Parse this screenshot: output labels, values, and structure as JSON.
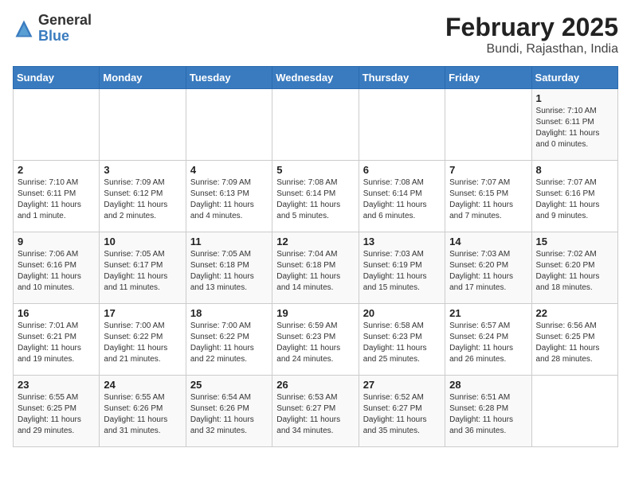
{
  "header": {
    "logo_general": "General",
    "logo_blue": "Blue",
    "title": "February 2025",
    "subtitle": "Bundi, Rajasthan, India"
  },
  "days_of_week": [
    "Sunday",
    "Monday",
    "Tuesday",
    "Wednesday",
    "Thursday",
    "Friday",
    "Saturday"
  ],
  "weeks": [
    [
      {
        "day": "",
        "info": ""
      },
      {
        "day": "",
        "info": ""
      },
      {
        "day": "",
        "info": ""
      },
      {
        "day": "",
        "info": ""
      },
      {
        "day": "",
        "info": ""
      },
      {
        "day": "",
        "info": ""
      },
      {
        "day": "1",
        "info": "Sunrise: 7:10 AM\nSunset: 6:11 PM\nDaylight: 11 hours\nand 0 minutes."
      }
    ],
    [
      {
        "day": "2",
        "info": "Sunrise: 7:10 AM\nSunset: 6:11 PM\nDaylight: 11 hours\nand 1 minute."
      },
      {
        "day": "3",
        "info": "Sunrise: 7:09 AM\nSunset: 6:12 PM\nDaylight: 11 hours\nand 2 minutes."
      },
      {
        "day": "4",
        "info": "Sunrise: 7:09 AM\nSunset: 6:13 PM\nDaylight: 11 hours\nand 4 minutes."
      },
      {
        "day": "5",
        "info": "Sunrise: 7:08 AM\nSunset: 6:14 PM\nDaylight: 11 hours\nand 5 minutes."
      },
      {
        "day": "6",
        "info": "Sunrise: 7:08 AM\nSunset: 6:14 PM\nDaylight: 11 hours\nand 6 minutes."
      },
      {
        "day": "7",
        "info": "Sunrise: 7:07 AM\nSunset: 6:15 PM\nDaylight: 11 hours\nand 7 minutes."
      },
      {
        "day": "8",
        "info": "Sunrise: 7:07 AM\nSunset: 6:16 PM\nDaylight: 11 hours\nand 9 minutes."
      }
    ],
    [
      {
        "day": "9",
        "info": "Sunrise: 7:06 AM\nSunset: 6:16 PM\nDaylight: 11 hours\nand 10 minutes."
      },
      {
        "day": "10",
        "info": "Sunrise: 7:05 AM\nSunset: 6:17 PM\nDaylight: 11 hours\nand 11 minutes."
      },
      {
        "day": "11",
        "info": "Sunrise: 7:05 AM\nSunset: 6:18 PM\nDaylight: 11 hours\nand 13 minutes."
      },
      {
        "day": "12",
        "info": "Sunrise: 7:04 AM\nSunset: 6:18 PM\nDaylight: 11 hours\nand 14 minutes."
      },
      {
        "day": "13",
        "info": "Sunrise: 7:03 AM\nSunset: 6:19 PM\nDaylight: 11 hours\nand 15 minutes."
      },
      {
        "day": "14",
        "info": "Sunrise: 7:03 AM\nSunset: 6:20 PM\nDaylight: 11 hours\nand 17 minutes."
      },
      {
        "day": "15",
        "info": "Sunrise: 7:02 AM\nSunset: 6:20 PM\nDaylight: 11 hours\nand 18 minutes."
      }
    ],
    [
      {
        "day": "16",
        "info": "Sunrise: 7:01 AM\nSunset: 6:21 PM\nDaylight: 11 hours\nand 19 minutes."
      },
      {
        "day": "17",
        "info": "Sunrise: 7:00 AM\nSunset: 6:22 PM\nDaylight: 11 hours\nand 21 minutes."
      },
      {
        "day": "18",
        "info": "Sunrise: 7:00 AM\nSunset: 6:22 PM\nDaylight: 11 hours\nand 22 minutes."
      },
      {
        "day": "19",
        "info": "Sunrise: 6:59 AM\nSunset: 6:23 PM\nDaylight: 11 hours\nand 24 minutes."
      },
      {
        "day": "20",
        "info": "Sunrise: 6:58 AM\nSunset: 6:23 PM\nDaylight: 11 hours\nand 25 minutes."
      },
      {
        "day": "21",
        "info": "Sunrise: 6:57 AM\nSunset: 6:24 PM\nDaylight: 11 hours\nand 26 minutes."
      },
      {
        "day": "22",
        "info": "Sunrise: 6:56 AM\nSunset: 6:25 PM\nDaylight: 11 hours\nand 28 minutes."
      }
    ],
    [
      {
        "day": "23",
        "info": "Sunrise: 6:55 AM\nSunset: 6:25 PM\nDaylight: 11 hours\nand 29 minutes."
      },
      {
        "day": "24",
        "info": "Sunrise: 6:55 AM\nSunset: 6:26 PM\nDaylight: 11 hours\nand 31 minutes."
      },
      {
        "day": "25",
        "info": "Sunrise: 6:54 AM\nSunset: 6:26 PM\nDaylight: 11 hours\nand 32 minutes."
      },
      {
        "day": "26",
        "info": "Sunrise: 6:53 AM\nSunset: 6:27 PM\nDaylight: 11 hours\nand 34 minutes."
      },
      {
        "day": "27",
        "info": "Sunrise: 6:52 AM\nSunset: 6:27 PM\nDaylight: 11 hours\nand 35 minutes."
      },
      {
        "day": "28",
        "info": "Sunrise: 6:51 AM\nSunset: 6:28 PM\nDaylight: 11 hours\nand 36 minutes."
      },
      {
        "day": "",
        "info": ""
      }
    ]
  ]
}
